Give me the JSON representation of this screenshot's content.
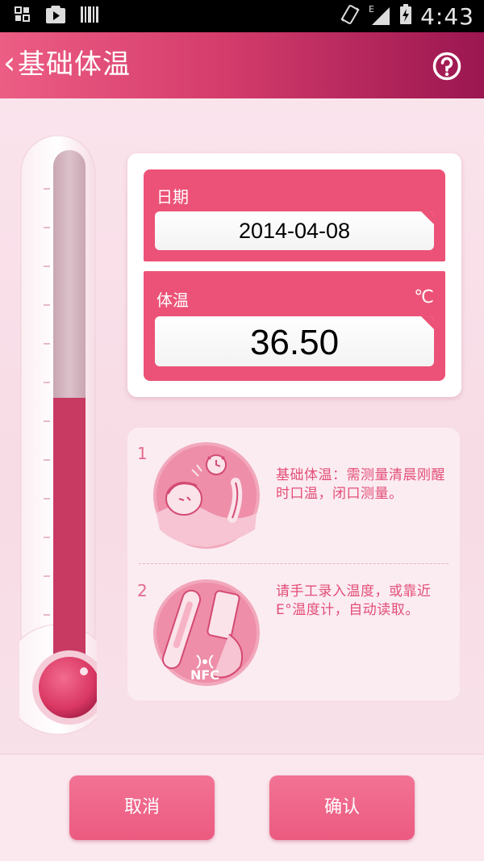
{
  "status_bar": {
    "network_type": "E",
    "time": "4:43"
  },
  "header": {
    "back_glyph": "‹",
    "title": "基础体温",
    "help_icon": "help-circle-icon"
  },
  "thermometer": {
    "level_fraction": 0.52
  },
  "form": {
    "date": {
      "label": "日期",
      "value": "2014-04-08"
    },
    "temperature": {
      "label": "体温",
      "unit": "℃",
      "value": "36.50"
    }
  },
  "tips": [
    {
      "number": "1",
      "text": "基础体温：需测量清晨刚醒时口温，闭口测量。"
    },
    {
      "number": "2",
      "text": "请手工录入温度，或靠近E°温度计，自动读取。",
      "badge": "NFC"
    }
  ],
  "actions": {
    "cancel_label": "取消",
    "confirm_label": "确认"
  },
  "colors": {
    "accent": "#ec5277",
    "header_start": "#ec5d84",
    "header_end": "#9b1650",
    "mercury": "#c83a62",
    "tip_text": "#e34e78"
  }
}
